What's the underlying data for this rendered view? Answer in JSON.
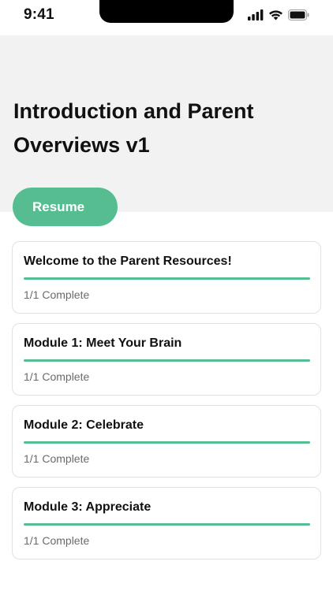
{
  "status_bar": {
    "time": "9:41",
    "icons": [
      "cellular-signal-icon",
      "wifi-icon",
      "battery-icon"
    ]
  },
  "header": {
    "title": "Introduction and Parent Overviews v1"
  },
  "resume_button": {
    "label": "Resume"
  },
  "colors": {
    "accent": "#55bd8f",
    "header_background": "#f2f2f2",
    "card_border": "#e2e2e2",
    "muted_text": "#6b6b6b"
  },
  "modules": [
    {
      "title": "Welcome to the Parent Resources!",
      "status": "1/1 Complete",
      "progress": 1.0
    },
    {
      "title": "Module 1: Meet Your Brain",
      "status": "1/1 Complete",
      "progress": 1.0
    },
    {
      "title": "Module 2: Celebrate",
      "status": "1/1 Complete",
      "progress": 1.0
    },
    {
      "title": "Module 3: Appreciate",
      "status": "1/1 Complete",
      "progress": 1.0
    }
  ]
}
